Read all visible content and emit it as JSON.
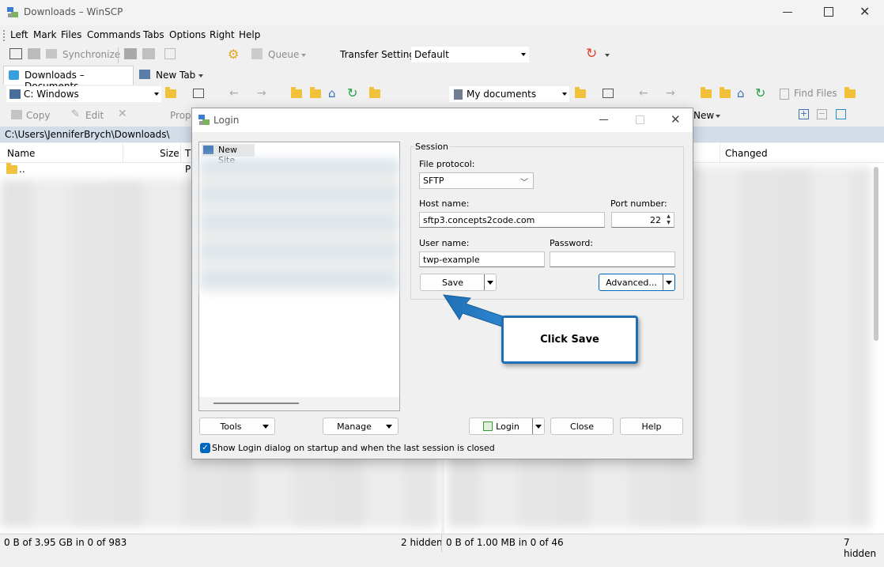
{
  "window": {
    "title": "Downloads – WinSCP"
  },
  "menu": [
    "Left",
    "Mark",
    "Files",
    "Commands",
    "Tabs",
    "Options",
    "Right",
    "Help"
  ],
  "toolbar": {
    "synchronize": "Synchronize",
    "queue": "Queue",
    "transfer_settings_label": "Transfer Settings",
    "transfer_settings_value": "Default"
  },
  "tabs": {
    "active": "Downloads – Documents",
    "new_tab": "New Tab"
  },
  "left_panel": {
    "drive": "C: Windows",
    "copy": "Copy",
    "edit": "Edit",
    "properties": "Prop",
    "path": "C:\\Users\\JenniferBrych\\Downloads\\",
    "col_name": "Name",
    "col_size": "Size",
    "col_type": "T",
    "parent_dir": "..",
    "parent_type": "P",
    "status_left": "0 B of 3.95 GB in 0 of 983",
    "status_hidden": "2 hidden"
  },
  "right_panel": {
    "location": "My documents",
    "find_files": "Find Files",
    "new": "New",
    "col_changed": "Changed",
    "status_left": "0 B of 1.00 MB in 0 of 46",
    "status_hidden": "7 hidden"
  },
  "login": {
    "title": "Login",
    "site_new": "New Site",
    "session_group": "Session",
    "file_protocol_label": "File protocol:",
    "file_protocol_value": "SFTP",
    "host_label": "Host name:",
    "host_value": "sftp3.concepts2code.com",
    "port_label": "Port number:",
    "port_value": "22",
    "user_label": "User name:",
    "user_value": "twp-example",
    "password_label": "Password:",
    "password_value": "",
    "save": "Save",
    "advanced": "Advanced...",
    "tools": "Tools",
    "manage": "Manage",
    "login_btn": "Login",
    "close": "Close",
    "help": "Help",
    "show_login": "Show Login dialog on startup and when the last session is closed"
  },
  "callout": {
    "text": "Click Save"
  },
  "colors": {
    "accent": "#0067c0",
    "callout_border": "#1f6fb5",
    "path_bar": "#d3dde8"
  }
}
